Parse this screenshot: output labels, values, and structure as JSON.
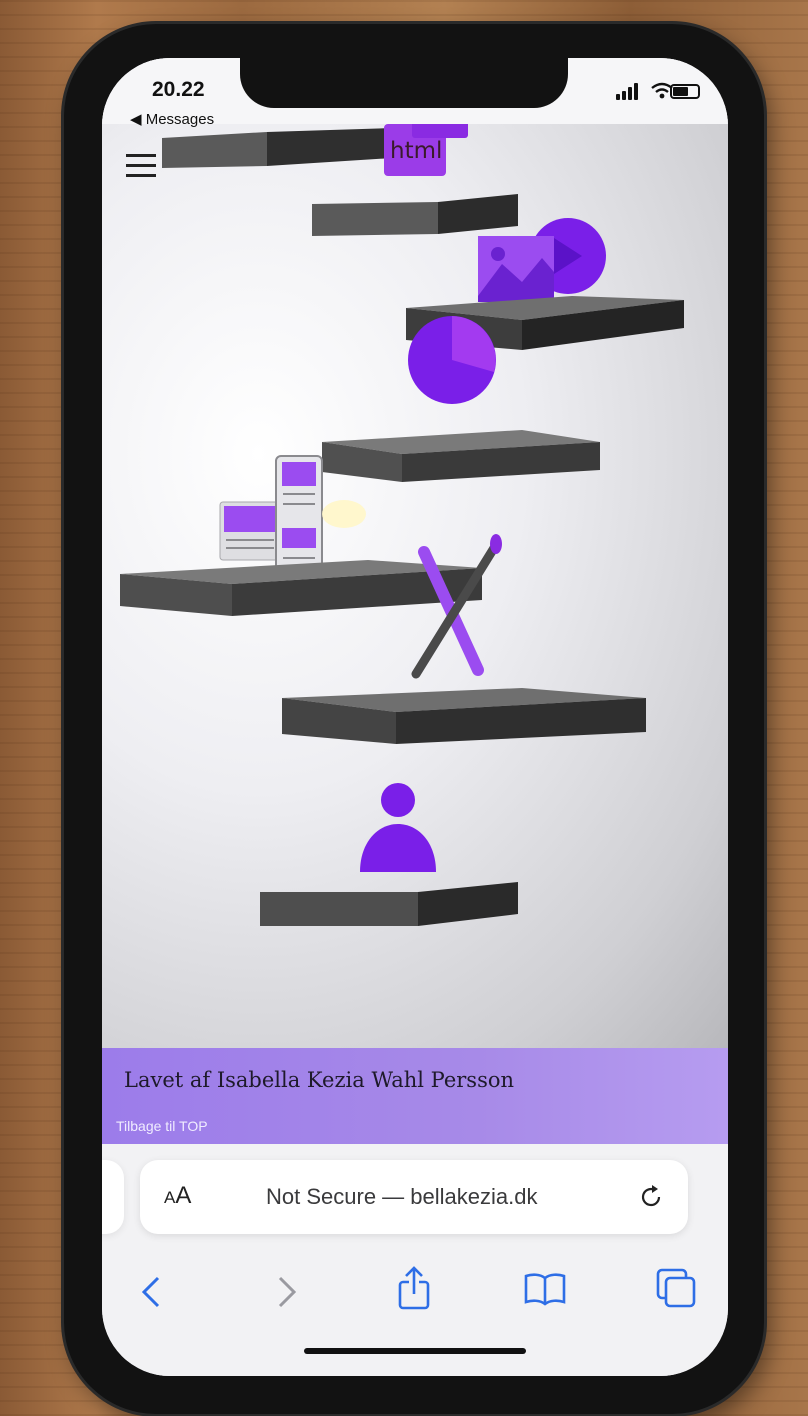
{
  "status_bar": {
    "time": "20.22",
    "back_app": "◀ Messages"
  },
  "page": {
    "footer_credit": "Lavet af Isabella Kezia Wahl Persson",
    "footer_link": "Tilbage til TOP",
    "html_badge": "html"
  },
  "browser": {
    "text_size_label_small": "A",
    "text_size_label_large": "A",
    "address": "Not Secure — bellakezia.dk"
  },
  "icons": {
    "menu": "hamburger-icon",
    "reload": "reload-icon",
    "back": "chevron-left-icon",
    "forward": "chevron-right-icon",
    "share": "share-icon",
    "bookmarks": "book-icon",
    "tabs": "tabs-icon"
  },
  "colors": {
    "accent_purple": "#8a2be2",
    "footer_band": "#a78ae8",
    "safari_blue": "#2e6ee6"
  }
}
